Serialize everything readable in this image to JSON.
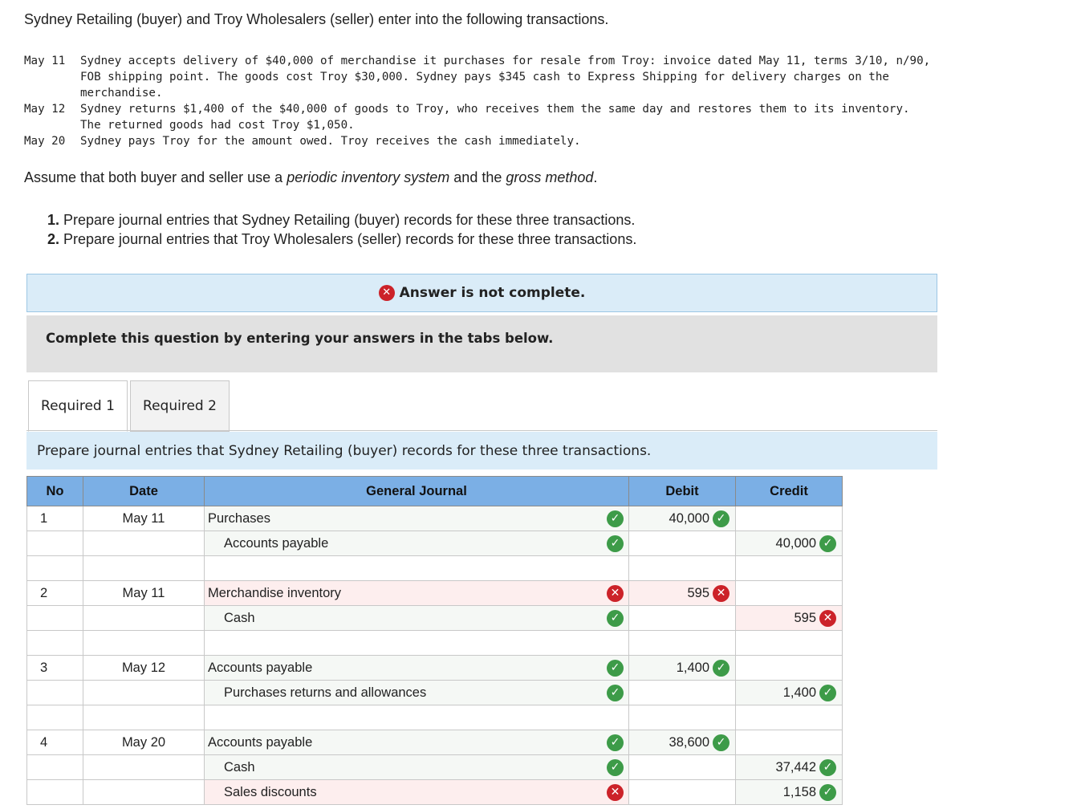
{
  "intro": "Sydney Retailing (buyer) and Troy Wholesalers (seller) enter into the following transactions.",
  "transactions": [
    {
      "date": "May 11",
      "text": "Sydney accepts delivery of $40,000 of merchandise it purchases for resale from Troy: invoice dated May 11, terms 3/10, n/90,\nFOB shipping point. The goods cost Troy $30,000. Sydney pays $345 cash to Express Shipping for delivery charges on the\nmerchandise."
    },
    {
      "date": "May 12",
      "text": "Sydney returns $1,400 of the $40,000 of goods to Troy, who receives them the same day and restores them to its inventory.\nThe returned goods had cost Troy $1,050."
    },
    {
      "date": "May 20",
      "text": "Sydney pays Troy for the amount owed. Troy receives the cash immediately."
    }
  ],
  "assume": {
    "pre": "Assume that both buyer and seller use a ",
    "em1": "periodic inventory system",
    "mid": " and the ",
    "em2": "gross method",
    "post": "."
  },
  "requirements": [
    {
      "num": "1.",
      "text": " Prepare journal entries that Sydney Retailing (buyer) records for these three transactions."
    },
    {
      "num": "2.",
      "text": " Prepare journal entries that Troy Wholesalers (seller) records for these three transactions."
    }
  ],
  "banner": "Answer is not complete.",
  "complete_msg": "Complete this question by entering your answers in the tabs below.",
  "tabs": [
    "Required 1",
    "Required 2"
  ],
  "instruction": "Prepare journal entries that Sydney Retailing (buyer) records for these three transactions.",
  "columns": {
    "no": "No",
    "date": "Date",
    "journal": "General Journal",
    "debit": "Debit",
    "credit": "Credit"
  },
  "rows": [
    {
      "no": "1",
      "date": "May 11",
      "account": "Purchases",
      "indent": false,
      "acct_status": "ok",
      "debit": "40,000",
      "debit_status": "ok",
      "credit": "",
      "credit_status": ""
    },
    {
      "no": "",
      "date": "",
      "account": "Accounts payable",
      "indent": true,
      "acct_status": "ok",
      "debit": "",
      "debit_status": "",
      "credit": "40,000",
      "credit_status": "ok"
    },
    {
      "no": "",
      "date": "",
      "account": "",
      "indent": false,
      "acct_status": "",
      "debit": "",
      "debit_status": "",
      "credit": "",
      "credit_status": ""
    },
    {
      "no": "2",
      "date": "May 11",
      "account": "Merchandise inventory",
      "indent": false,
      "acct_status": "bad",
      "debit": "595",
      "debit_status": "bad",
      "credit": "",
      "credit_status": ""
    },
    {
      "no": "",
      "date": "",
      "account": "Cash",
      "indent": true,
      "acct_status": "ok",
      "debit": "",
      "debit_status": "",
      "credit": "595",
      "credit_status": "bad"
    },
    {
      "no": "",
      "date": "",
      "account": "",
      "indent": false,
      "acct_status": "",
      "debit": "",
      "debit_status": "",
      "credit": "",
      "credit_status": ""
    },
    {
      "no": "3",
      "date": "May 12",
      "account": "Accounts payable",
      "indent": false,
      "acct_status": "ok",
      "debit": "1,400",
      "debit_status": "ok",
      "credit": "",
      "credit_status": ""
    },
    {
      "no": "",
      "date": "",
      "account": "Purchases returns and allowances",
      "indent": true,
      "acct_status": "ok",
      "debit": "",
      "debit_status": "",
      "credit": "1,400",
      "credit_status": "ok"
    },
    {
      "no": "",
      "date": "",
      "account": "",
      "indent": false,
      "acct_status": "",
      "debit": "",
      "debit_status": "",
      "credit": "",
      "credit_status": ""
    },
    {
      "no": "4",
      "date": "May 20",
      "account": "Accounts payable",
      "indent": false,
      "acct_status": "ok",
      "debit": "38,600",
      "debit_status": "ok",
      "credit": "",
      "credit_status": ""
    },
    {
      "no": "",
      "date": "",
      "account": "Cash",
      "indent": true,
      "acct_status": "ok",
      "debit": "",
      "debit_status": "",
      "credit": "37,442",
      "credit_status": "ok"
    },
    {
      "no": "",
      "date": "",
      "account": "Sales discounts",
      "indent": true,
      "acct_status": "bad",
      "debit": "",
      "debit_status": "",
      "credit": "1,158",
      "credit_status": "ok"
    }
  ],
  "colors": {
    "header_bg": "#7bafe5",
    "ok": "#3d9b48",
    "bad": "#cc2229",
    "banner_bg": "#daecf8"
  },
  "icons": {
    "ok": "check-icon",
    "bad": "x-icon"
  }
}
